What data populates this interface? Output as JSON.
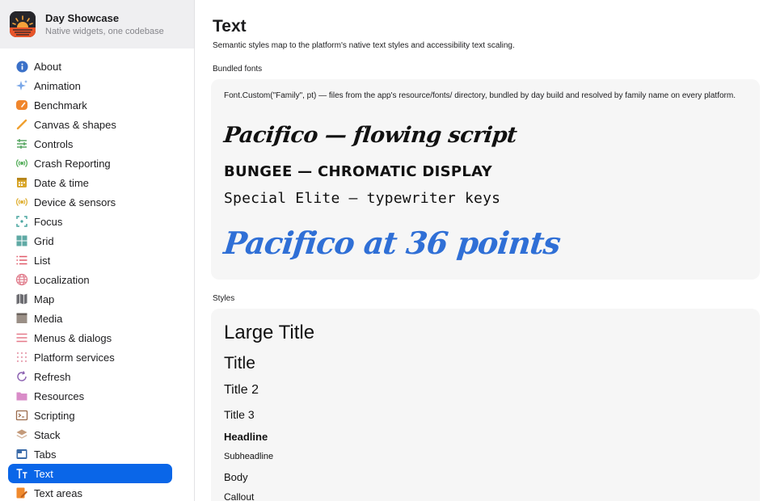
{
  "app": {
    "name": "Day Showcase",
    "subtitle": "Native widgets, one codebase"
  },
  "sidebar": {
    "items": [
      {
        "label": "About",
        "icon": "info-icon",
        "color": "#3a70c8"
      },
      {
        "label": "Animation",
        "icon": "sparkles-icon",
        "color": "#7aa7e8"
      },
      {
        "label": "Benchmark",
        "icon": "speedometer-icon",
        "color": "#f0862d"
      },
      {
        "label": "Canvas & shapes",
        "icon": "paintbrush-icon",
        "color": "#f0a030"
      },
      {
        "label": "Controls",
        "icon": "sliders-icon",
        "color": "#4fa35a"
      },
      {
        "label": "Crash Reporting",
        "icon": "broadcast-icon",
        "color": "#58b05e"
      },
      {
        "label": "Date & time",
        "icon": "calendar-icon",
        "color": "#d9a72b"
      },
      {
        "label": "Device & sensors",
        "icon": "sensor-icon",
        "color": "#e0b23a"
      },
      {
        "label": "Focus",
        "icon": "focus-icon",
        "color": "#4aa6a0"
      },
      {
        "label": "Grid",
        "icon": "grid-icon",
        "color": "#5fa9a4"
      },
      {
        "label": "List",
        "icon": "list-icon",
        "color": "#e05a6a"
      },
      {
        "label": "Localization",
        "icon": "globe-icon",
        "color": "#e07a8a"
      },
      {
        "label": "Map",
        "icon": "map-icon",
        "color": "#6d6d72"
      },
      {
        "label": "Media",
        "icon": "film-icon",
        "color": "#9a8f86"
      },
      {
        "label": "Menus & dialogs",
        "icon": "menu-lines-icon",
        "color": "#e57a8a"
      },
      {
        "label": "Platform services",
        "icon": "dots-grid-icon",
        "color": "#e8a0b0"
      },
      {
        "label": "Refresh",
        "icon": "refresh-icon",
        "color": "#8a5fb0"
      },
      {
        "label": "Resources",
        "icon": "folder-icon",
        "color": "#d98cc8"
      },
      {
        "label": "Scripting",
        "icon": "terminal-icon",
        "color": "#9a6a4a"
      },
      {
        "label": "Stack",
        "icon": "stack-icon",
        "color": "#c49a7a"
      },
      {
        "label": "Tabs",
        "icon": "tabs-icon",
        "color": "#3a6aa8"
      },
      {
        "label": "Text",
        "icon": "text-size-icon",
        "color": "#ffffff",
        "active": true
      },
      {
        "label": "Text areas",
        "icon": "edit-icon",
        "color": "#f08a2d"
      }
    ]
  },
  "main": {
    "title": "Text",
    "subtitle": "Semantic styles map to the platform's native text styles and accessibility text scaling.",
    "bundled_fonts": {
      "label": "Bundled fonts",
      "description": "Font.Custom(\"Family\", pt) — files from the app's resource/fonts/ directory, bundled by day build and resolved by family name on every platform.",
      "samples": [
        "Pacifico — flowing script",
        "Bungee — chromatic display",
        "Special Elite — typewriter keys",
        "Pacifico at 36 points"
      ],
      "large_sample_color": "#2f6fd6"
    },
    "styles": {
      "label": "Styles",
      "items": [
        "Large Title",
        "Title",
        "Title 2",
        "Title 3",
        "Headline",
        "Subheadline",
        "Body",
        "Callout"
      ]
    }
  },
  "colors": {
    "accent": "#0a66e8",
    "card_background": "#f6f6f6",
    "sidebar_header": "#efeff1"
  }
}
